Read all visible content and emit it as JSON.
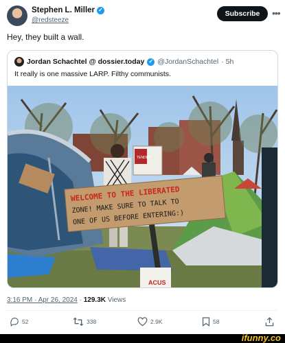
{
  "author": {
    "name": "Stephen L. Miller",
    "handle": "@redsteeze",
    "subscribe_label": "Subscribe",
    "more_icon": "ellipsis-icon"
  },
  "tweet": {
    "text": "Hey, they built a wall."
  },
  "quoted": {
    "name": "Jordan Schachtel @ dossier.today",
    "handle": "@JordanSchachtel",
    "age": "· 5h",
    "text": "It really is one massive LARP. Filthy communists.",
    "sign_line1": "WELCOME TO THE LIBERATED",
    "sign_line2": "ZONE! MAKE SURE TO TALK TO",
    "sign_line3": "ONE OF US BEFORE ENTERING:)",
    "small_sign": "TENDER",
    "bag_text": "ACUS"
  },
  "meta": {
    "time": "3:16 PM · Apr 26, 2024",
    "views_count": "129.3K",
    "views_label": "Views"
  },
  "actions": {
    "replies": "52",
    "reposts": "338",
    "likes": "2.9K",
    "bookmarks": "58"
  },
  "colors": {
    "verified": "#1d9bf0",
    "text": "#0f1419",
    "muted": "#536471"
  },
  "watermark": {
    "text": "ifunny.co"
  }
}
